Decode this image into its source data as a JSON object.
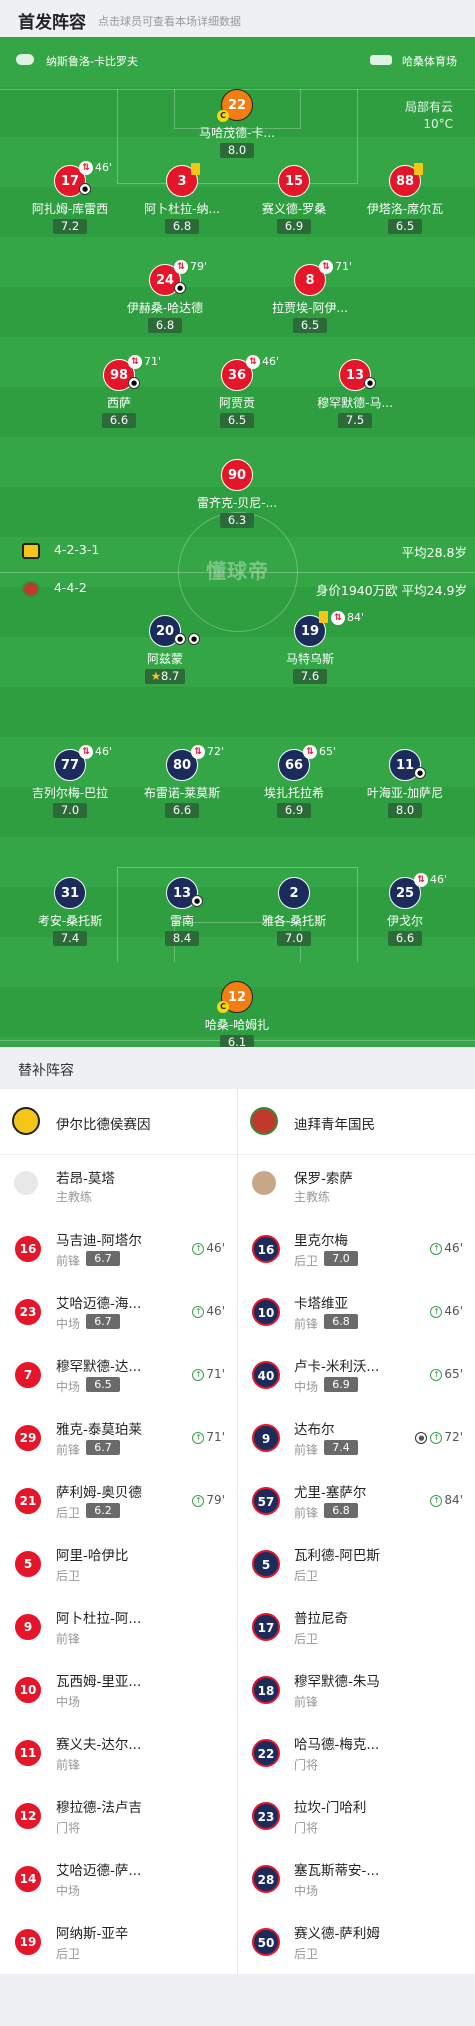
{
  "header": {
    "title": "首发阵容",
    "subtitle": "点击球员可查看本场详细数据"
  },
  "pitch": {
    "home_team_top": "纳斯鲁洛-卡比罗夫",
    "venue": "哈桑体育场",
    "weather": "局部有云",
    "temperature": "10°C",
    "watermark": "懂球帝",
    "away_formation": "4-2-3-1",
    "away_avg_age": "平均28.8岁",
    "home_formation": "4-4-2",
    "home_value_age": "身价1940万欧 平均24.9岁"
  },
  "top_players": [
    {
      "num": "22",
      "name": "马哈茂德-卡...",
      "rating": "8.0",
      "color": "orange"
    },
    {
      "num": "17",
      "name": "阿扎姆-库雷西",
      "rating": "7.2",
      "sub_minute": "46'"
    },
    {
      "num": "3",
      "name": "阿卜杜拉-纳...",
      "rating": "6.8"
    },
    {
      "num": "15",
      "name": "赛义德-罗桑",
      "rating": "6.9"
    },
    {
      "num": "88",
      "name": "伊塔洛-席尔瓦",
      "rating": "6.5"
    },
    {
      "num": "24",
      "name": "伊赫桑-哈达德",
      "rating": "6.8",
      "sub_minute": "79'"
    },
    {
      "num": "8",
      "name": "拉贾埃-阿伊...",
      "rating": "6.5",
      "sub_minute": "71'"
    },
    {
      "num": "98",
      "name": "西萨",
      "rating": "6.6",
      "sub_minute": "71'"
    },
    {
      "num": "36",
      "name": "阿贾贡",
      "rating": "6.5",
      "sub_minute": "46'"
    },
    {
      "num": "13",
      "name": "穆罕默德-马...",
      "rating": "7.5"
    },
    {
      "num": "90",
      "name": "雷齐克-贝尼-...",
      "rating": "6.3"
    }
  ],
  "bottom_players": [
    {
      "num": "20",
      "name": "阿兹蒙",
      "rating": "8.7"
    },
    {
      "num": "19",
      "name": "马特乌斯",
      "rating": "7.6",
      "sub_minute": "84'"
    },
    {
      "num": "77",
      "name": "吉列尔梅-巴拉",
      "rating": "7.0",
      "sub_minute": "46'"
    },
    {
      "num": "80",
      "name": "布雷诺-莱莫斯",
      "rating": "6.6",
      "sub_minute": "72'"
    },
    {
      "num": "66",
      "name": "埃扎托拉希",
      "rating": "6.9",
      "sub_minute": "65'"
    },
    {
      "num": "11",
      "name": "叶海亚-加萨尼",
      "rating": "8.0"
    },
    {
      "num": "31",
      "name": "考安-桑托斯",
      "rating": "7.4"
    },
    {
      "num": "13",
      "name": "雷南",
      "rating": "8.4"
    },
    {
      "num": "2",
      "name": "雅各-桑托斯",
      "rating": "7.0"
    },
    {
      "num": "25",
      "name": "伊戈尔",
      "rating": "6.6",
      "sub_minute": "46'"
    },
    {
      "num": "12",
      "name": "哈桑-哈姆扎",
      "rating": "6.1",
      "color": "orange"
    }
  ],
  "subs_section": {
    "title": "替补阵容"
  },
  "left_team": {
    "name": "伊尔比德侯赛因",
    "coach_name": "若昂-莫塔",
    "coach_role": "主教练",
    "subs": [
      {
        "num": "16",
        "name": "马吉迪-阿塔尔",
        "pos": "前锋",
        "rating": "6.7",
        "minute": "46'"
      },
      {
        "num": "23",
        "name": "艾哈迈德-海...",
        "pos": "中场",
        "rating": "6.7",
        "minute": "46'"
      },
      {
        "num": "7",
        "name": "穆罕默德-达...",
        "pos": "中场",
        "rating": "6.5",
        "minute": "71'"
      },
      {
        "num": "29",
        "name": "雅克-泰莫珀莱",
        "pos": "前锋",
        "rating": "6.7",
        "minute": "71'"
      },
      {
        "num": "21",
        "name": "萨利姆-奥贝德",
        "pos": "后卫",
        "rating": "6.2",
        "minute": "79'"
      },
      {
        "num": "5",
        "name": "阿里-哈伊比",
        "pos": "后卫"
      },
      {
        "num": "9",
        "name": "阿卜杜拉-阿...",
        "pos": "前锋"
      },
      {
        "num": "10",
        "name": "瓦西姆-里亚...",
        "pos": "中场"
      },
      {
        "num": "11",
        "name": "赛义夫-达尔...",
        "pos": "前锋"
      },
      {
        "num": "12",
        "name": "穆拉德-法卢吉",
        "pos": "门将"
      },
      {
        "num": "14",
        "name": "艾哈迈德-萨...",
        "pos": "中场"
      },
      {
        "num": "19",
        "name": "阿纳斯-亚辛",
        "pos": "后卫"
      }
    ]
  },
  "right_team": {
    "name": "迪拜青年国民",
    "coach_name": "保罗-索萨",
    "coach_role": "主教练",
    "subs": [
      {
        "num": "16",
        "name": "里克尔梅",
        "pos": "后卫",
        "rating": "7.0",
        "minute": "46'"
      },
      {
        "num": "10",
        "name": "卡塔维亚",
        "pos": "前锋",
        "rating": "6.8",
        "minute": "46'"
      },
      {
        "num": "40",
        "name": "卢卡-米利沃...",
        "pos": "中场",
        "rating": "6.9",
        "minute": "65'"
      },
      {
        "num": "9",
        "name": "达布尔",
        "pos": "前锋",
        "rating": "7.4",
        "minute": "72'",
        "goal": true
      },
      {
        "num": "57",
        "name": "尤里-塞萨尔",
        "pos": "前锋",
        "rating": "6.8",
        "minute": "84'"
      },
      {
        "num": "5",
        "name": "瓦利德-阿巴斯",
        "pos": "后卫"
      },
      {
        "num": "17",
        "name": "普拉尼奇",
        "pos": "后卫"
      },
      {
        "num": "18",
        "name": "穆罕默德-朱马",
        "pos": "前锋"
      },
      {
        "num": "22",
        "name": "哈马德-梅克...",
        "pos": "门将"
      },
      {
        "num": "23",
        "name": "拉坎-门哈利",
        "pos": "门将"
      },
      {
        "num": "28",
        "name": "塞瓦斯蒂安-...",
        "pos": "中场"
      },
      {
        "num": "50",
        "name": "赛义德-萨利姆",
        "pos": "后卫"
      }
    ]
  },
  "colors": {
    "red": "#e5152a",
    "orange": "#f27d12",
    "navy": "#1b2b5c",
    "pitch": "#2f9e40"
  }
}
